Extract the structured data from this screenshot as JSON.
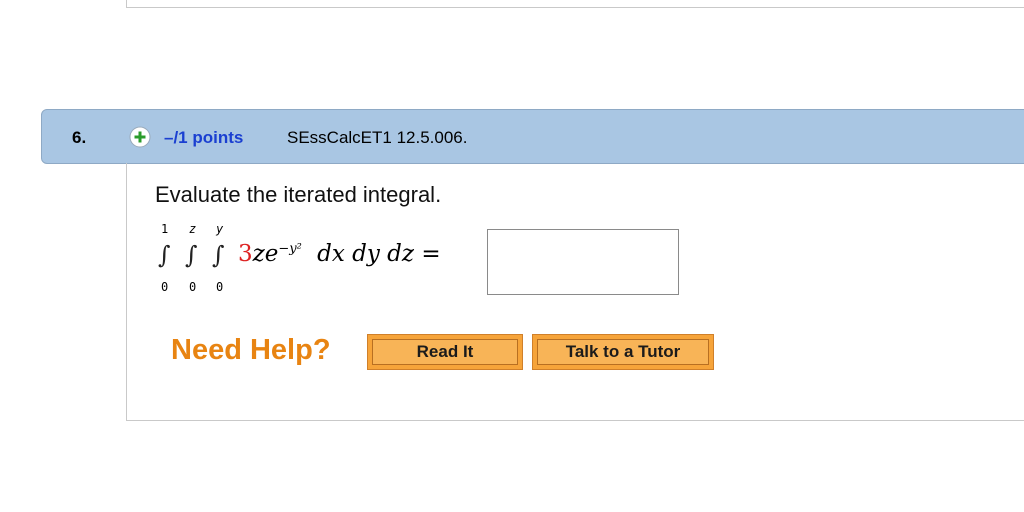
{
  "question": {
    "number": "6.",
    "points": "–/1 points",
    "id": "SEssCalcET1 12.5.006.",
    "prompt": "Evaluate the iterated integral."
  },
  "integral": {
    "upper_limits": [
      "1",
      "z",
      "y"
    ],
    "lower_limits": [
      "0",
      "0",
      "0"
    ],
    "coefficient": "3",
    "integrand_rest": "ze",
    "exponent": "−y²",
    "differentials": "dx dy dz =",
    "answer_value": ""
  },
  "help": {
    "label": "Need Help?",
    "read_it": "Read It",
    "talk_to_tutor": "Talk to a Tutor"
  },
  "colors": {
    "header_bg": "#a9c6e3",
    "points_blue": "#1a3fd1",
    "help_orange": "#e88412",
    "button_orange": "#f6a43a",
    "plus_green": "#2b9c2b"
  }
}
